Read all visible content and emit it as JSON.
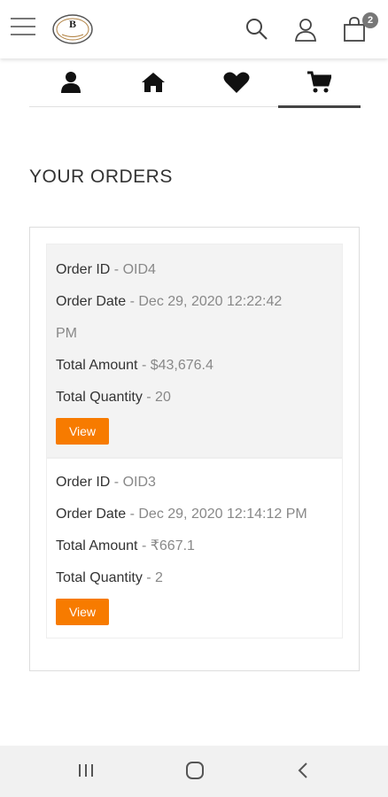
{
  "header": {
    "cart_count": "2"
  },
  "page": {
    "title": "YOUR ORDERS"
  },
  "orders": [
    {
      "id_label": "Order ID",
      "id_value": "OID4",
      "date_label": "Order Date",
      "date_value": "Dec 29, 2020 12:22:42",
      "date_value_cont": "PM",
      "amount_label": "Total Amount",
      "amount_value": "$43,676.4",
      "qty_label": "Total Quantity",
      "qty_value": "20",
      "view_label": "View"
    },
    {
      "id_label": "Order ID",
      "id_value": "OID3",
      "date_label": "Order Date",
      "date_value": "Dec 29, 2020 12:14:12 PM",
      "amount_label": "Total Amount",
      "amount_value": "₹667.1",
      "qty_label": "Total Quantity",
      "qty_value": "2",
      "view_label": "View"
    }
  ],
  "separator": " - ",
  "colors": {
    "accent": "#f77b00",
    "text": "#333333",
    "muted": "#888888",
    "card_highlight": "#f3f3f3"
  },
  "icons": [
    "menu-icon",
    "logo",
    "search-icon",
    "user-icon",
    "shopping-bag-icon",
    "profile-tab-icon",
    "home-tab-icon",
    "heart-tab-icon",
    "cart-tab-icon",
    "recents-icon",
    "home-nav-icon",
    "back-icon"
  ]
}
